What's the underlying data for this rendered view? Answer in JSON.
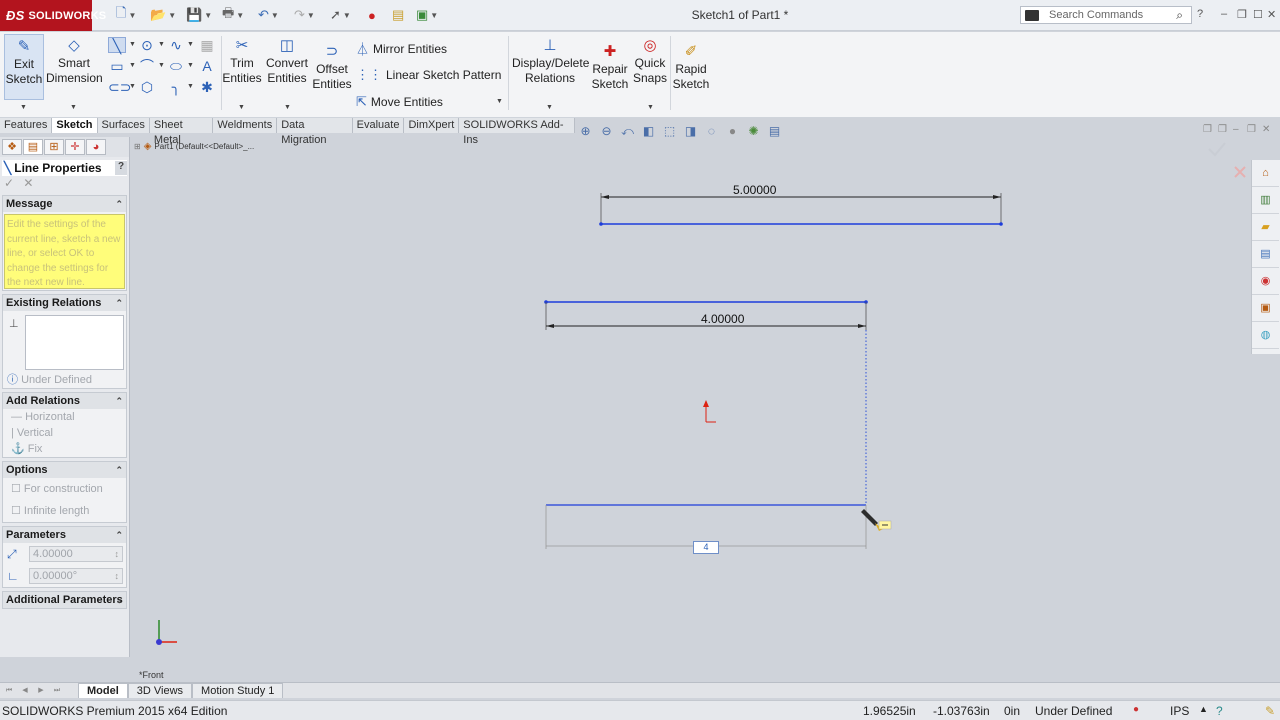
{
  "app": {
    "logo_text": "SOLIDWORKS",
    "doc_title": "Sketch1 of Part1 *",
    "search_placeholder": "Search Commands"
  },
  "ribbon": {
    "exit_sketch": "Exit Sketch",
    "smart_dimension": "Smart Dimension",
    "trim_entities": "Trim Entities",
    "convert_entities": "Convert Entities",
    "offset_entities": "Offset Entities",
    "mirror_entities": "Mirror Entities",
    "linear_sketch_pattern": "Linear Sketch Pattern",
    "move_entities": "Move Entities",
    "display_delete_relations": "Display/Delete Relations",
    "repair_sketch": "Repair Sketch",
    "quick_snaps": "Quick Snaps",
    "rapid_sketch": "Rapid Sketch"
  },
  "cm_tabs": [
    "Features",
    "Sketch",
    "Surfaces",
    "Sheet Metal",
    "Weldments",
    "Data Migration",
    "Evaluate",
    "DimXpert",
    "SOLIDWORKS Add-Ins"
  ],
  "cm_active_tab": "Sketch",
  "breadcrumb": "Part1  (Default<<Default>_...",
  "property_manager": {
    "title": "Line Properties",
    "help": "?",
    "message_header": "Message",
    "message_text": "Edit the settings of the current line, sketch a new line, or select OK to change the settings for the next new line.",
    "existing_relations_header": "Existing Relations",
    "under_defined": "Under Defined",
    "add_relations_header": "Add Relations",
    "add_relations": [
      "Horizontal",
      "Vertical",
      "Fix"
    ],
    "options_header": "Options",
    "options": [
      "For construction",
      "Infinite length"
    ],
    "parameters_header": "Parameters",
    "length_value": "4.00000",
    "angle_value": "0.00000°",
    "additional_parameters_header": "Additional Parameters"
  },
  "sketch": {
    "dim_top": "5.00000",
    "dim_mid": "4.00000",
    "dim_input": "4",
    "view_label": "*Front"
  },
  "bottom_tabs": [
    "Model",
    "3D Views",
    "Motion Study 1"
  ],
  "bottom_active_tab": "Model",
  "status": {
    "edition": "SOLIDWORKS Premium 2015 x64 Edition",
    "x": "1.96525in",
    "y": "-1.03763in",
    "z": "0in",
    "state": "Under Defined",
    "units": "IPS"
  },
  "colors": {
    "brand_red": "#b3141e",
    "sketch_blue": "#1d3ddb",
    "message_yellow": "#fffd7a"
  }
}
